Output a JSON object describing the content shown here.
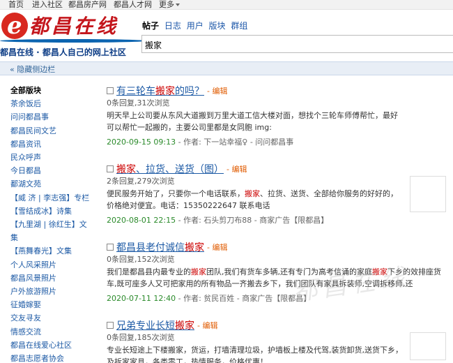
{
  "topnav": {
    "items": [
      "首页",
      "进入社区",
      "都昌房产网",
      "都昌人才网",
      "更多"
    ]
  },
  "header": {
    "logo_letter": "e",
    "logo_text": "都昌在线",
    "slogan": "都昌在线 · 都昌人自己的网上社区",
    "search_tabs": [
      "帖子",
      "日志",
      "用户",
      "版块",
      "群组"
    ],
    "search_value": "搬家"
  },
  "toggle": {
    "label": "« 隐藏侧边栏"
  },
  "sidebar": {
    "items": [
      "全部版块",
      "茶余饭后",
      "问问都昌事",
      "都昌民间文艺",
      "都昌资讯",
      "民众呼声",
      "今日都昌",
      "鄱湖文苑",
      "【威 济 | 李志强】专栏",
      "【雪结成冰】诗集",
      "【九里湖 | 徐红生】文集",
      "【燕舞春光】文集",
      "个人风采照片",
      "都昌风景照片",
      "户外旅游照片",
      "征婚嫁娶",
      "交友寻友",
      "情感交流",
      "都昌在线爱心社区",
      "都昌志愿者协会"
    ]
  },
  "posts": [
    {
      "title_pre": "有三轮车",
      "title_hl": "搬家",
      "title_post": "的吗？",
      "edit": "- 编辑",
      "stats": "0条回复,31次浏览",
      "body": "明天早上公司要从东风大道搬到万里大道工信大楼对面，想找个三轮车师傅帮忙，最好可以帮忙一起搬的，主要公司里都是女同胞 img: http://www.duchang.org/mobcent/app/data/smilies/01 ..",
      "date": "2020-09-15 09:13",
      "meta": " - 作者: 下一站幸福♀ - 问问都昌事"
    },
    {
      "title_pre": "",
      "title_hl": "搬家",
      "title_post": "、拉货、送货（图）",
      "edit": "- 编辑",
      "stats": "2条回复,279次浏览",
      "body_pre": "便民服务开始了，只要你一个电话联系，",
      "body_hl": "搬家",
      "body_post": "、拉货、送货、全部给你服务的好好的，价格绝对便宜。电话：15350222647 联系电话",
      "date": "2020-08-01 22:15",
      "meta": " - 作者: 石头剪刀布88 - 商家广告【限都昌】"
    },
    {
      "title_pre": "都昌县老付诚信",
      "title_hl": "搬家",
      "title_post": "",
      "edit": "- 编辑",
      "stats": "0条回复,152次浏览",
      "body_pre": "我们是都昌县内最专业的",
      "body_hl": "搬家",
      "body_mid": "团队,我们有货车多辆,还有专门为高考信诵的家庭",
      "body_hl2": "搬家",
      "body_post": "下乡的效排座货车,既可座多人又可把家用的所有物品一齐搬去乡下，我们团队有家具拆装师,空调拆移师,还",
      "date": "2020-07-11 12:40",
      "meta": " - 作者: 贫民百姓 - 商家广告【限都昌】"
    },
    {
      "title_pre": "兄弟专业长短",
      "title_hl": "搬家",
      "title_post": "",
      "edit": "- 编辑",
      "stats": "0条回复,185次浏览",
      "body": "专业长短途上下楼搬家，货运，打墙清理垃圾，护墙板上楼及代驾,装货卸货,送货下乡，及拆家家具，各类零工，热情服务，价格优惠！"
    }
  ],
  "watermark": "都昌在线"
}
